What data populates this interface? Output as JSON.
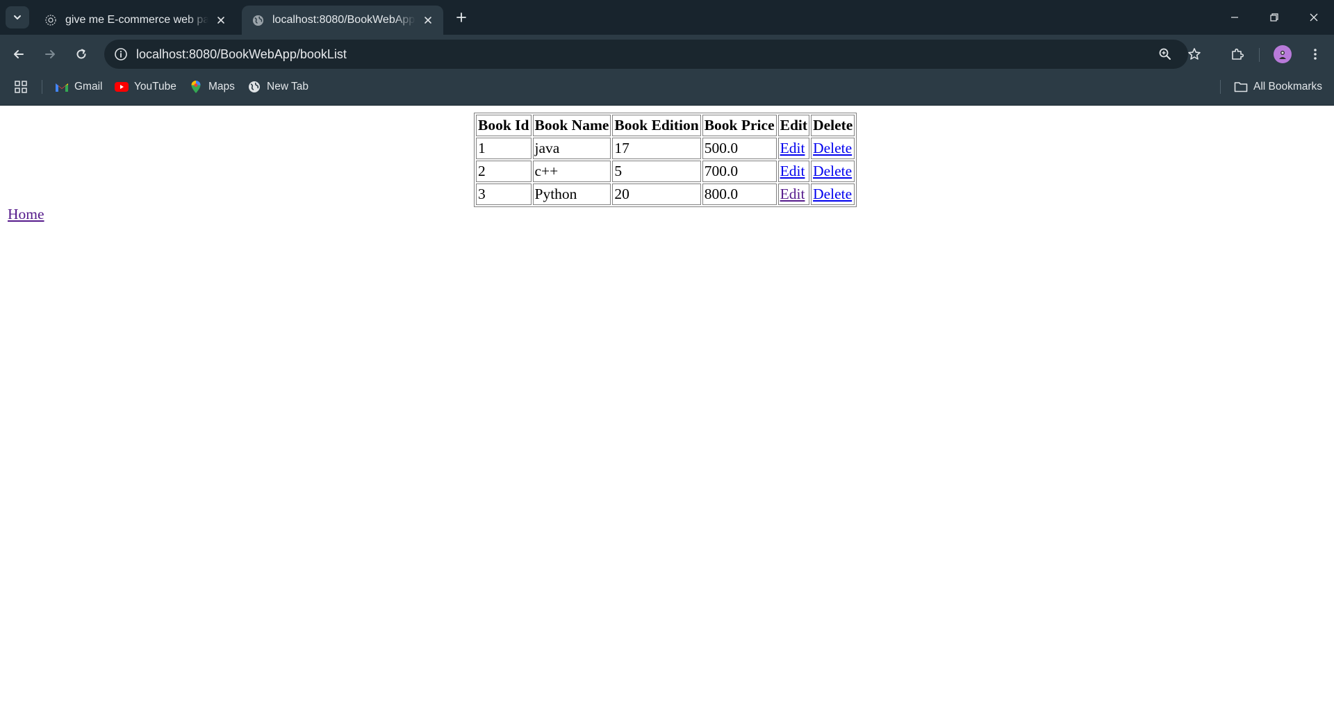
{
  "browser": {
    "tabs": [
      {
        "title": "give me E-commerce web page",
        "active": false
      },
      {
        "title": "localhost:8080/BookWebApp/bookList",
        "active": true
      }
    ],
    "url": "localhost:8080/BookWebApp/bookList",
    "bookmarks": [
      {
        "label": "Gmail",
        "icon": "gmail-icon"
      },
      {
        "label": "YouTube",
        "icon": "youtube-icon"
      },
      {
        "label": "Maps",
        "icon": "maps-icon"
      },
      {
        "label": "New Tab",
        "icon": "globe-icon"
      }
    ],
    "all_bookmarks_label": "All Bookmarks",
    "colors": {
      "frame": "#18242d",
      "toolbar": "#2c3b45",
      "omnibox": "#1a262e",
      "link": "#0000ee",
      "visited_link": "#551a8b"
    }
  },
  "table": {
    "headers": [
      "Book Id",
      "Book Name",
      "Book Edition",
      "Book Price",
      "Edit",
      "Delete"
    ],
    "rows": [
      {
        "id": "1",
        "name": "java",
        "edition": "17",
        "price": "500.0",
        "edit": "Edit",
        "delete": "Delete"
      },
      {
        "id": "2",
        "name": "c++",
        "edition": "5",
        "price": "700.0",
        "edit": "Edit",
        "delete": "Delete"
      },
      {
        "id": "3",
        "name": "Python",
        "edition": "20",
        "price": "800.0",
        "edit": "Edit",
        "delete": "Delete"
      }
    ]
  },
  "home_link": "Home"
}
